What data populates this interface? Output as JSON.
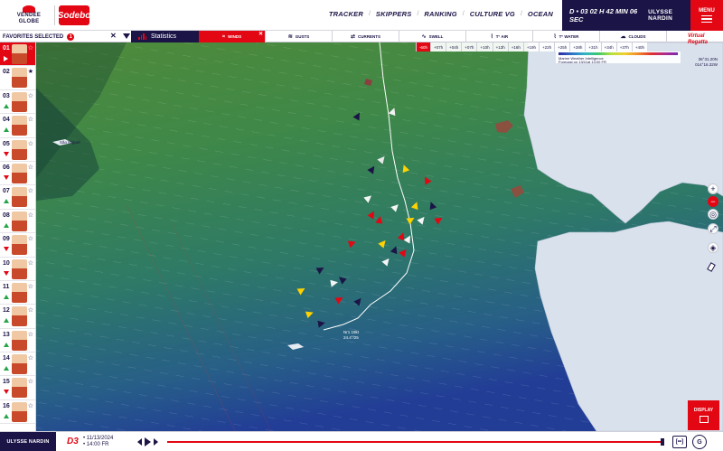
{
  "header": {
    "logo_line1": "VENDÉE",
    "logo_line2": "GLOBE",
    "sponsor": "Sodebo",
    "nav": [
      "TRACKER",
      "SKIPPERS",
      "RANKING",
      "CULTURE VG",
      "OCEAN"
    ],
    "clock": "D • 03 02 H 42 MIN 06 SEC",
    "brand": "ULYSSE NARDIN",
    "menu_label": "MENU"
  },
  "subbar": {
    "favorites_label": "FAVORITES SELECTED",
    "favorites_count": "1",
    "stats_label": "Statistics",
    "layers": [
      {
        "label": "WINDS",
        "glyph": "≈",
        "active": true
      },
      {
        "label": "GUSTS",
        "glyph": "≋",
        "active": false
      },
      {
        "label": "CURRENTS",
        "glyph": "⇄",
        "active": false
      },
      {
        "label": "SWELL",
        "glyph": "∿",
        "active": false
      },
      {
        "label": "T° AIR",
        "glyph": "⌇",
        "active": false
      },
      {
        "label": "T° WATER",
        "glyph": "⌇",
        "active": false
      },
      {
        "label": "CLOUDS",
        "glyph": "☁",
        "active": false
      }
    ]
  },
  "scale": {
    "steps": [
      "-60h",
      "+07h",
      "+04h",
      "+07h",
      "+10h",
      "+13h",
      "+16h",
      "+19h",
      "+22h",
      "+25h",
      "+28h",
      "+31h",
      "+34h",
      "+37h",
      "+40h"
    ],
    "highlight": "-60h",
    "legend_line1": "Marine Weather Intelligence",
    "legend_line2": "Forecast on 13/11at 13:00 FR"
  },
  "virtual_regatta": {
    "line1": "Virtual",
    "line2": "Regatta"
  },
  "coords": {
    "lat": "36°31.20N",
    "lon": "014°16.32W"
  },
  "map": {
    "place_label": "São Miguel",
    "boat_label_line1": "Nr1 19kt",
    "boat_label_line2": "24.4°/25"
  },
  "skippers": [
    {
      "rank": "01",
      "trend": "play",
      "active": true,
      "star": "☆"
    },
    {
      "rank": "02",
      "trend": "none",
      "active": false,
      "star": "★"
    },
    {
      "rank": "03",
      "trend": "up",
      "active": false,
      "star": "☆"
    },
    {
      "rank": "04",
      "trend": "up",
      "active": false,
      "star": "☆"
    },
    {
      "rank": "05",
      "trend": "down",
      "active": false,
      "star": "☆"
    },
    {
      "rank": "06",
      "trend": "down",
      "active": false,
      "star": "☆"
    },
    {
      "rank": "07",
      "trend": "up",
      "active": false,
      "star": "☆"
    },
    {
      "rank": "08",
      "trend": "up",
      "active": false,
      "star": "☆"
    },
    {
      "rank": "09",
      "trend": "down",
      "active": false,
      "star": "☆"
    },
    {
      "rank": "10",
      "trend": "down",
      "active": false,
      "star": "☆"
    },
    {
      "rank": "11",
      "trend": "up",
      "active": false,
      "star": "☆"
    },
    {
      "rank": "12",
      "trend": "up",
      "active": false,
      "star": "☆"
    },
    {
      "rank": "13",
      "trend": "up",
      "active": false,
      "star": "☆"
    },
    {
      "rank": "14",
      "trend": "up",
      "active": false,
      "star": "☆"
    },
    {
      "rank": "15",
      "trend": "down",
      "active": false,
      "star": "☆"
    },
    {
      "rank": "16",
      "trend": "up",
      "active": false,
      "star": "☆"
    }
  ],
  "controls": {
    "zoom_in": "+",
    "zoom_out": "−",
    "display_label": "DISPLAY"
  },
  "bottom": {
    "brand": "ULYSSE NARDIN",
    "day": "D3",
    "date": "• 11/13/2024",
    "time": "• 14:00 FR",
    "live_label": "[••]",
    "share_label": "G"
  },
  "colors": {
    "navy": "#1b1446",
    "red": "#e30613",
    "land": "#d9e1ec"
  }
}
